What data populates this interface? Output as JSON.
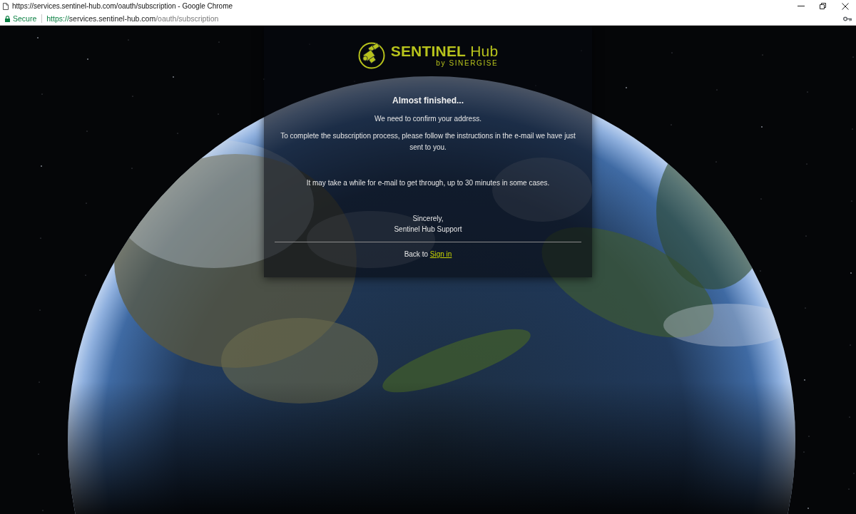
{
  "window": {
    "title": "https://services.sentinel-hub.com/oauth/subscription - Google Chrome"
  },
  "address_bar": {
    "security": "Secure",
    "url_scheme": "https://",
    "url_host": "services.sentinel-hub.com",
    "url_path": "/oauth/subscription"
  },
  "logo": {
    "wordmark": "**SENTINEL** Hub",
    "byline": "by SINERGISE"
  },
  "card": {
    "heading": "Almost finished...",
    "paragraphs": [
      "We need to confirm your address.",
      "To complete the subscription process, please follow the instructions in the e-mail we have just sent to you.",
      "It may take a while for e-mail to get through, up to 30 minutes in some cases."
    ],
    "closing": "Sincerely,",
    "signature": "Sentinel Hub Support",
    "footer_text": "Back to",
    "footer_link": "Sign in"
  }
}
